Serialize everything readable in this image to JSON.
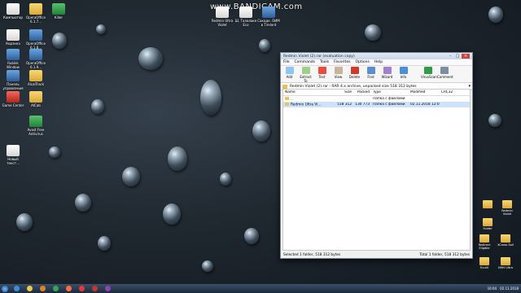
{
  "watermark": "www.BANDICAM.com",
  "desktop_left_icons": [
    {
      "label": "Компьютер",
      "kind": "white"
    },
    {
      "label": "OperaOffice 6.1.7...",
      "kind": "folder"
    },
    {
      "label": "Killer",
      "kind": "green"
    },
    {
      "label": "Корзина",
      "kind": "white"
    },
    {
      "label": "OperaOffice 6.1.8...",
      "kind": "app"
    },
    {
      "label": "Rubikk Window",
      "kind": "app"
    },
    {
      "label": "OperaOffice 6.1.9...",
      "kind": "app"
    },
    {
      "label": "Панель управления",
      "kind": "app"
    },
    {
      "label": "AlcalTrack",
      "kind": "folder"
    },
    {
      "label": "Game Center",
      "kind": "red"
    },
    {
      "label": "AICab",
      "kind": "folder"
    },
    {
      "label": "Avast Free Antivirus",
      "kind": "green"
    },
    {
      "label": "Новый текст...",
      "kind": "white"
    }
  ],
  "desktop_top_icons": [
    {
      "label": "Redmin Ultra Violet",
      "kind": "white"
    },
    {
      "label": "Ш. Талалаке Eco",
      "kind": "white"
    },
    {
      "label": "Сакаде. ОИМ в Tirelord",
      "kind": "app"
    }
  ],
  "desktop_right_icons": [
    {
      "label": "",
      "kind": "folder"
    },
    {
      "label": "Redmin Violet",
      "kind": "folder"
    },
    {
      "label": "Folder",
      "kind": "folder"
    },
    {
      "label": "Redirect Eligible",
      "kind": "folder"
    },
    {
      "label": "XCross Soil",
      "kind": "folder"
    },
    {
      "label": "Ecutil",
      "kind": "folder"
    },
    {
      "label": "ИНН Ultra",
      "kind": "folder"
    }
  ],
  "window": {
    "title": "Redmin Violet (2).rar (evaluation copy)",
    "menu": [
      "File",
      "Commands",
      "Tools",
      "Favorites",
      "Options",
      "Help"
    ],
    "toolbar": [
      {
        "label": "Add",
        "color": "#8fc5f2"
      },
      {
        "label": "Extract To",
        "color": "#9fcf88"
      },
      {
        "label": "Test",
        "color": "#e74c3c"
      },
      {
        "label": "View",
        "color": "#c7b49a"
      },
      {
        "label": "Delete",
        "color": "#d0392b"
      },
      {
        "label": "Find",
        "color": "#5e8ccf"
      },
      {
        "label": "Wizard",
        "color": "#a37fcf"
      },
      {
        "label": "Info",
        "color": "#4a90d9"
      },
      {
        "label": "VirusScan",
        "color": "#2e9e44"
      },
      {
        "label": "Comment",
        "color": "#7b8da1"
      }
    ],
    "path": "Redmin Violet (2).rar - RAR 4.x archive, unpacked size 518 312 bytes",
    "columns": [
      "Name",
      "Size",
      "Packed",
      "Type",
      "Modified",
      "CRC32"
    ],
    "rows": [
      {
        "name": "..",
        "size": "",
        "packed": "",
        "type": "Папка с файлами",
        "modified": "",
        "crc": ""
      },
      {
        "name": "Redmin Ultra Vi...",
        "size": "518 312",
        "packed": "130 773",
        "type": "Папка с файлами",
        "modified": "02.11.2018 12:03",
        "crc": ""
      }
    ],
    "status_left": "Selected 1 folder, 518 312 bytes",
    "status_right": "Total 1 folder, 518 312 bytes"
  },
  "taskbar": {
    "apps": [
      {
        "name": "ie",
        "color": "#3b8edc"
      },
      {
        "name": "explorer",
        "color": "#f2c94c"
      },
      {
        "name": "media",
        "color": "#e67e22"
      },
      {
        "name": "chrome",
        "color": "#34a853"
      },
      {
        "name": "firefox",
        "color": "#ff7139"
      },
      {
        "name": "yandex",
        "color": "#e53935"
      },
      {
        "name": "bandicam",
        "color": "#c0392b"
      },
      {
        "name": "winrar",
        "color": "#8e44ad"
      }
    ],
    "clock": "16:04",
    "date": "02.11.2018"
  }
}
